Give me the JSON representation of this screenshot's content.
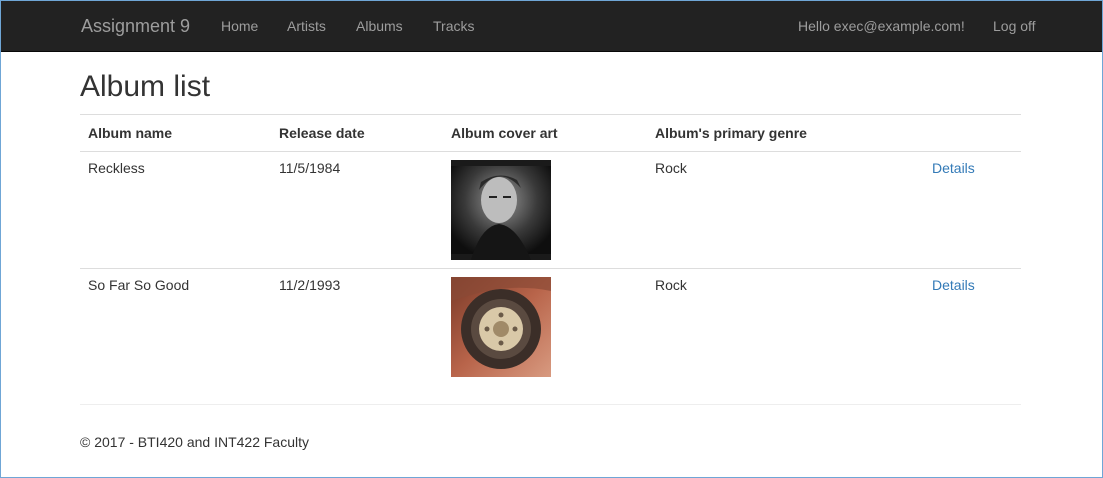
{
  "nav": {
    "brand": "Assignment 9",
    "links": [
      "Home",
      "Artists",
      "Albums",
      "Tracks"
    ],
    "greeting": "Hello exec@example.com!",
    "logoff": "Log off"
  },
  "page": {
    "title": "Album list"
  },
  "table": {
    "headers": [
      "Album name",
      "Release date",
      "Album cover art",
      "Album's primary genre"
    ],
    "rows": [
      {
        "name": "Reckless",
        "date": "11/5/1984",
        "genre": "Rock",
        "action": "Details",
        "cover_icon": "reckless-cover-art"
      },
      {
        "name": "So Far So Good",
        "date": "11/2/1993",
        "genre": "Rock",
        "action": "Details",
        "cover_icon": "so-far-so-good-cover-art"
      }
    ]
  },
  "footer": {
    "text": "© 2017 - BTI420 and INT422 Faculty"
  }
}
